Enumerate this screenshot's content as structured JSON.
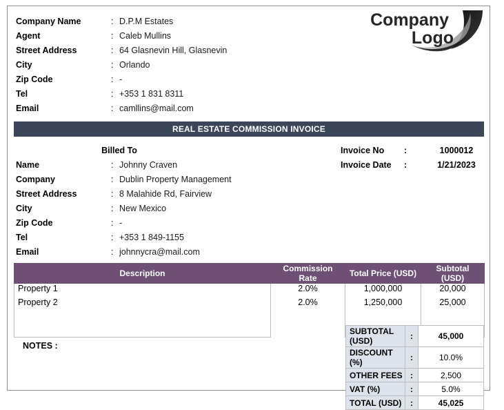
{
  "document": {
    "title_bar": "REAL ESTATE COMMISSION INVOICE",
    "notes_label": "NOTES :"
  },
  "logo": {
    "line1": "Company",
    "line2": "Logo",
    "icon": "swoosh-graphic"
  },
  "seller": {
    "rows": [
      {
        "label": "Company Name",
        "colon": ":",
        "value": "D.P.M Estates"
      },
      {
        "label": "Agent",
        "colon": ":",
        "value": "Caleb Mullins"
      },
      {
        "label": "Street Address",
        "colon": ":",
        "value": "64 Glasnevin Hill, Glasnevin"
      },
      {
        "label": "City",
        "colon": ":",
        "value": "Orlando"
      },
      {
        "label": "Zip Code",
        "colon": ":",
        "value": "-"
      },
      {
        "label": "Tel",
        "colon": ":",
        "value": "+353 1 831 8311"
      },
      {
        "label": "Email",
        "colon": ":",
        "value": "camllins@mail.com"
      }
    ]
  },
  "billed_to": {
    "heading": "Billed To",
    "rows": [
      {
        "label": "Name",
        "colon": ":",
        "value": "Johnny Craven"
      },
      {
        "label": "Company",
        "colon": ":",
        "value": "Dublin Property Management"
      },
      {
        "label": "Street Address",
        "colon": ":",
        "value": "8 Malahide Rd, Fairview"
      },
      {
        "label": "City",
        "colon": ":",
        "value": "New Mexico"
      },
      {
        "label": "Zip Code",
        "colon": ":",
        "value": "-"
      },
      {
        "label": "Tel",
        "colon": ":",
        "value": "+353 1 849-1155"
      },
      {
        "label": "Email",
        "colon": ":",
        "value": "johnnycra@mail.com"
      }
    ]
  },
  "invoice_meta": {
    "rows": [
      {
        "label": "Invoice No",
        "colon": ":",
        "value": "1000012"
      },
      {
        "label": "Invoice Date",
        "colon": ":",
        "value": "1/21/2023"
      }
    ]
  },
  "items": {
    "headers": [
      "Description",
      "Commission Rate",
      "Total Price (USD)",
      "Subtotal (USD)"
    ],
    "rows": [
      {
        "description": "Property 1",
        "rate": "2.0%",
        "price": "1,000,000",
        "subtotal": "20,000"
      },
      {
        "description": "Property 2",
        "rate": "2.0%",
        "price": "1,250,000",
        "subtotal": "25,000"
      }
    ]
  },
  "totals": {
    "rows": [
      {
        "label": "SUBTOTAL (USD)",
        "colon": ":",
        "value": "45,000"
      },
      {
        "label": "DISCOUNT (%)",
        "colon": ":",
        "value": "10.0%"
      },
      {
        "label": "OTHER FEES",
        "colon": ":",
        "value": "2,500"
      },
      {
        "label": "VAT (%)",
        "colon": ":",
        "value": "5.0%"
      },
      {
        "label": "TOTAL (USD)",
        "colon": ":",
        "value": "45,025"
      }
    ]
  },
  "colors": {
    "title_bar_bg": "#3b4659",
    "table_header_bg": "#6d5074",
    "totals_label_bg": "#dce3ec",
    "border": "#bdbdbd",
    "frame_border": "#8f8f8f"
  }
}
